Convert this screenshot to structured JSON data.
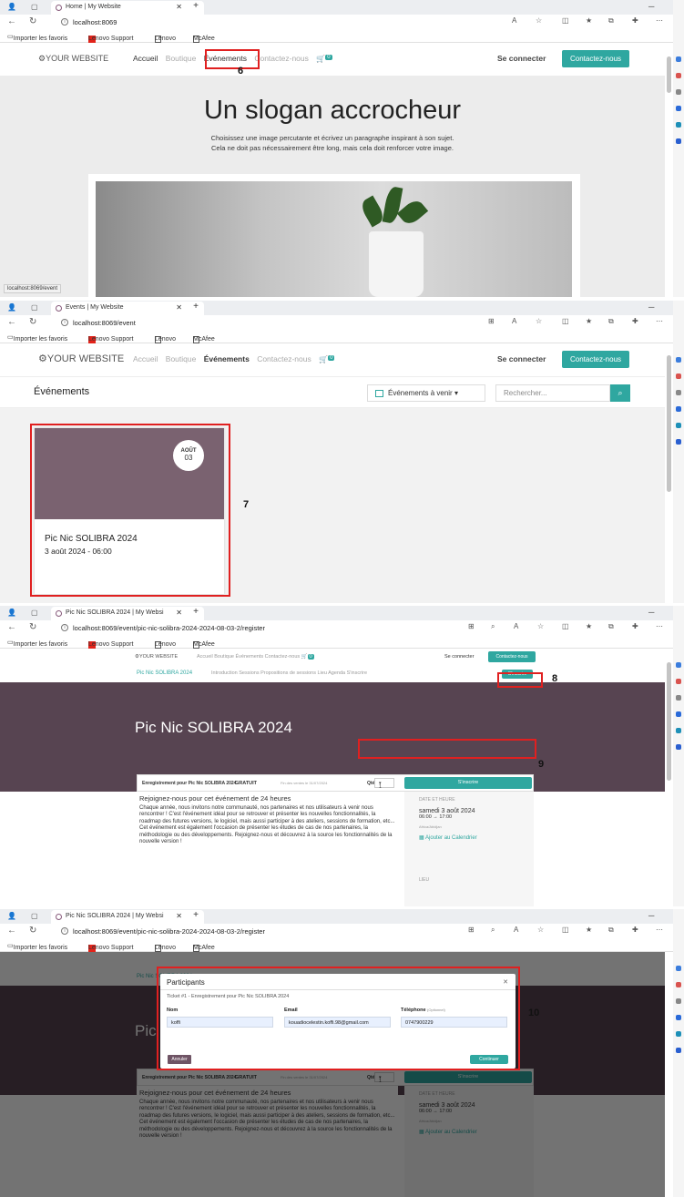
{
  "browser": {
    "tab_titles": [
      "Home | My Website",
      "Events | My Website",
      "Pic Nic SOLIBRA 2024 | My Websi",
      "Pic Nic SOLIBRA 2024 | My Websi"
    ],
    "urls": [
      "localhost:8069",
      "localhost:8069/event",
      "localhost:8069/event/pic-nic-solibra-2024-2024-08-03-2/register",
      "localhost:8069/event/pic-nic-solibra-2024-2024-08-03-2/register"
    ],
    "favorites": {
      "import": "Importer les favoris",
      "lenovo_support": "Lenovo Support",
      "lenovo": "Lenovo",
      "mcafee": "McAfee"
    },
    "status_url": "localhost:8069/event"
  },
  "site": {
    "logo": "YOUR WEBSITE",
    "menu": [
      "Accueil",
      "Boutique",
      "Événements",
      "Contactez-nous"
    ],
    "cart_count": "0",
    "login": "Se connecter",
    "contact_button": "Contactez-nous"
  },
  "home": {
    "headline": "Un slogan accrocheur",
    "line1": "Choisissez une image percutante et écrivez un paragraphe inspirant à son sujet.",
    "line2": "Cela ne doit pas nécessairement être long, mais cela doit renforcer votre image."
  },
  "events_page": {
    "title": "Événements",
    "filter": "Événements à venir",
    "search_placeholder": "Rechercher...",
    "card": {
      "month": "AOÛT",
      "day": "03",
      "name": "Pic Nic SOLIBRA 2024",
      "when": "3 août 2024 - 06:00"
    }
  },
  "event_page": {
    "name": "Pic Nic SOLIBRA 2024",
    "subnav": "Introduction   Sessions   Propositions de sessions   Lieu   Agenda   S'inscrire",
    "register_button": "S'inscrire",
    "reg_label": "Enregistrement pour Pic Nic SOLIBRA 2024",
    "price": "GRATUIT",
    "sales_end": "Fin des ventes le 31/07/2024",
    "qty_label": "Qté",
    "qty_value": "1",
    "desc_title": "Rejoignez-nous pour cet événement de 24 heures",
    "desc_text": "Chaque année, nous invitons notre communauté, nos partenaires et nos utilisateurs à venir nous rencontrer ! C'est l'événement idéal pour se retrouver et présenter les nouvelles fonctionnalités, la roadmap des futures versions, le logiciel, mais aussi participer à des ateliers, sessions de formation, etc... Cet événement est également l'occasion de présenter les études de cas de nos partenaires, la méthodologie ou des développements. Rejoignez-nous et découvrez à la source les fonctionnalités de la nouvelle version !",
    "date_heading": "DATE ET HEURE",
    "date": "samedi 3 août 2024",
    "time": "06:00 → 17:00",
    "timezone": "Africa/Abidjan",
    "add_calendar": "Ajouter au Calendrier",
    "place_heading": "LIEU"
  },
  "modal": {
    "title": "Participants",
    "ticket": "Ticket #1 - Enregistrement pour Pic Nic SOLIBRA 2024",
    "name_label": "Nom",
    "email_label": "Email",
    "phone_label": "Téléphone",
    "phone_optional": "(Optionnel)",
    "name_value": "koffi",
    "email_value": "kouadiocelestin.koffi.98@gmail.com",
    "phone_value": "0747900229",
    "cancel": "Annuler",
    "continue": "Continuer"
  },
  "annotations": [
    "6",
    "7",
    "8",
    "9",
    "10"
  ],
  "colors": {
    "accent": "#2fa7a0",
    "event_cover": "#7a6270",
    "banner": "#574451",
    "highlight": "#e02020"
  }
}
